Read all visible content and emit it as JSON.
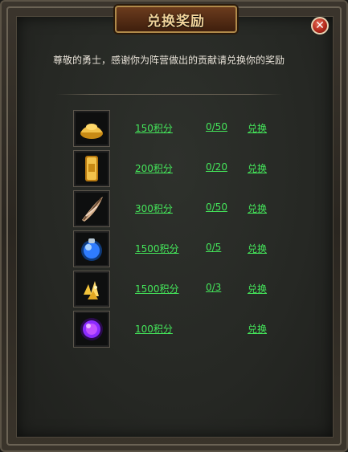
{
  "dialog": {
    "title": "兑换奖励",
    "intro": "尊敬的勇士，感谢你为阵营做出的贡献请兑换你的奖励",
    "close_icon": "close-icon"
  },
  "rewards": [
    {
      "icon": "gold-ingot-icon",
      "cost": "150积分",
      "progress": "0/50",
      "action": "兑换"
    },
    {
      "icon": "gold-bar-icon",
      "cost": "200积分",
      "progress": "0/20",
      "action": "兑换"
    },
    {
      "icon": "feather-icon",
      "cost": "300积分",
      "progress": "0/50",
      "action": "兑换"
    },
    {
      "icon": "blue-potion-orb-icon",
      "cost": "1500积分",
      "progress": "0/5",
      "action": "兑换"
    },
    {
      "icon": "gold-crystal-icon",
      "cost": "1500积分",
      "progress": "0/3",
      "action": "兑换"
    },
    {
      "icon": "purple-orb-icon",
      "cost": "100积分",
      "progress": "",
      "action": "兑换"
    }
  ],
  "colors": {
    "link_green": "#44e65a",
    "title_gold": "#f2d39a"
  }
}
